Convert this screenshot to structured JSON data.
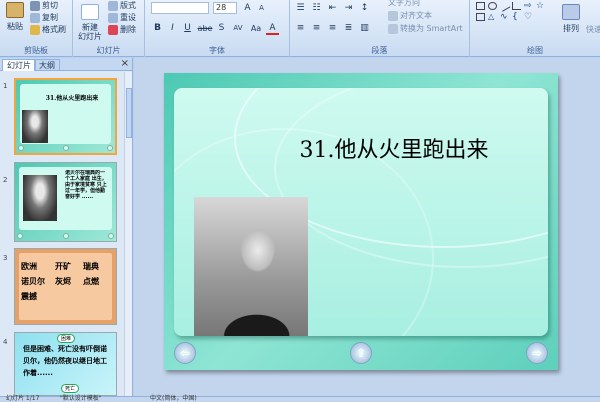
{
  "ribbon": {
    "clipboard": {
      "paste": "粘贴",
      "cut": "剪切",
      "copy": "复制",
      "format_painter": "格式刷",
      "label": "剪贴板"
    },
    "slides": {
      "new_slide": "新建\n幻灯片",
      "layout": "版式",
      "reset": "重设",
      "delete": "删除",
      "label": "幻灯片"
    },
    "font": {
      "font_name": "",
      "font_size": "28",
      "bold": "B",
      "italic": "I",
      "underline": "U",
      "strike": "abe",
      "shadow": "S",
      "spacing": "AV",
      "case": "Aa",
      "color": "A",
      "label": "字体"
    },
    "paragraph": {
      "text_direction": "文字方向",
      "align_text": "对齐文本",
      "smartart": "转换为 SmartArt",
      "label": "段落"
    },
    "drawing": {
      "arrange": "排列",
      "quick_styles": "快速",
      "label": "绘图"
    }
  },
  "left_panel": {
    "tabs": [
      "幻灯片",
      "大纲"
    ],
    "close": "×",
    "slides": [
      {
        "number": "1",
        "title": "31.他从火里跑出来"
      },
      {
        "number": "2",
        "text": "诺贝尔在瑞典的一个工人家庭 出生，由于家境贫寒 只上过一年学，但他勤奋好学 ......"
      },
      {
        "number": "3",
        "words": [
          "欧洲",
          "开矿",
          "瑞典",
          "诺贝尔",
          "灰烬",
          "点燃",
          "震撼"
        ]
      },
      {
        "number": "4",
        "text": "但是困难、死亡没有吓倒诺贝尔，他仍然夜以继日地工作着......",
        "bubble1": "困难",
        "bubble2": "死亡"
      }
    ]
  },
  "slide": {
    "title": "31.他从火里跑出来",
    "nav": [
      "⇦",
      "⇧",
      "⇨"
    ]
  },
  "status_bar": {
    "slide_info": "幻灯片 1/17",
    "theme": "\"默认设计模板\"",
    "language": "中文(简体，中国)"
  }
}
